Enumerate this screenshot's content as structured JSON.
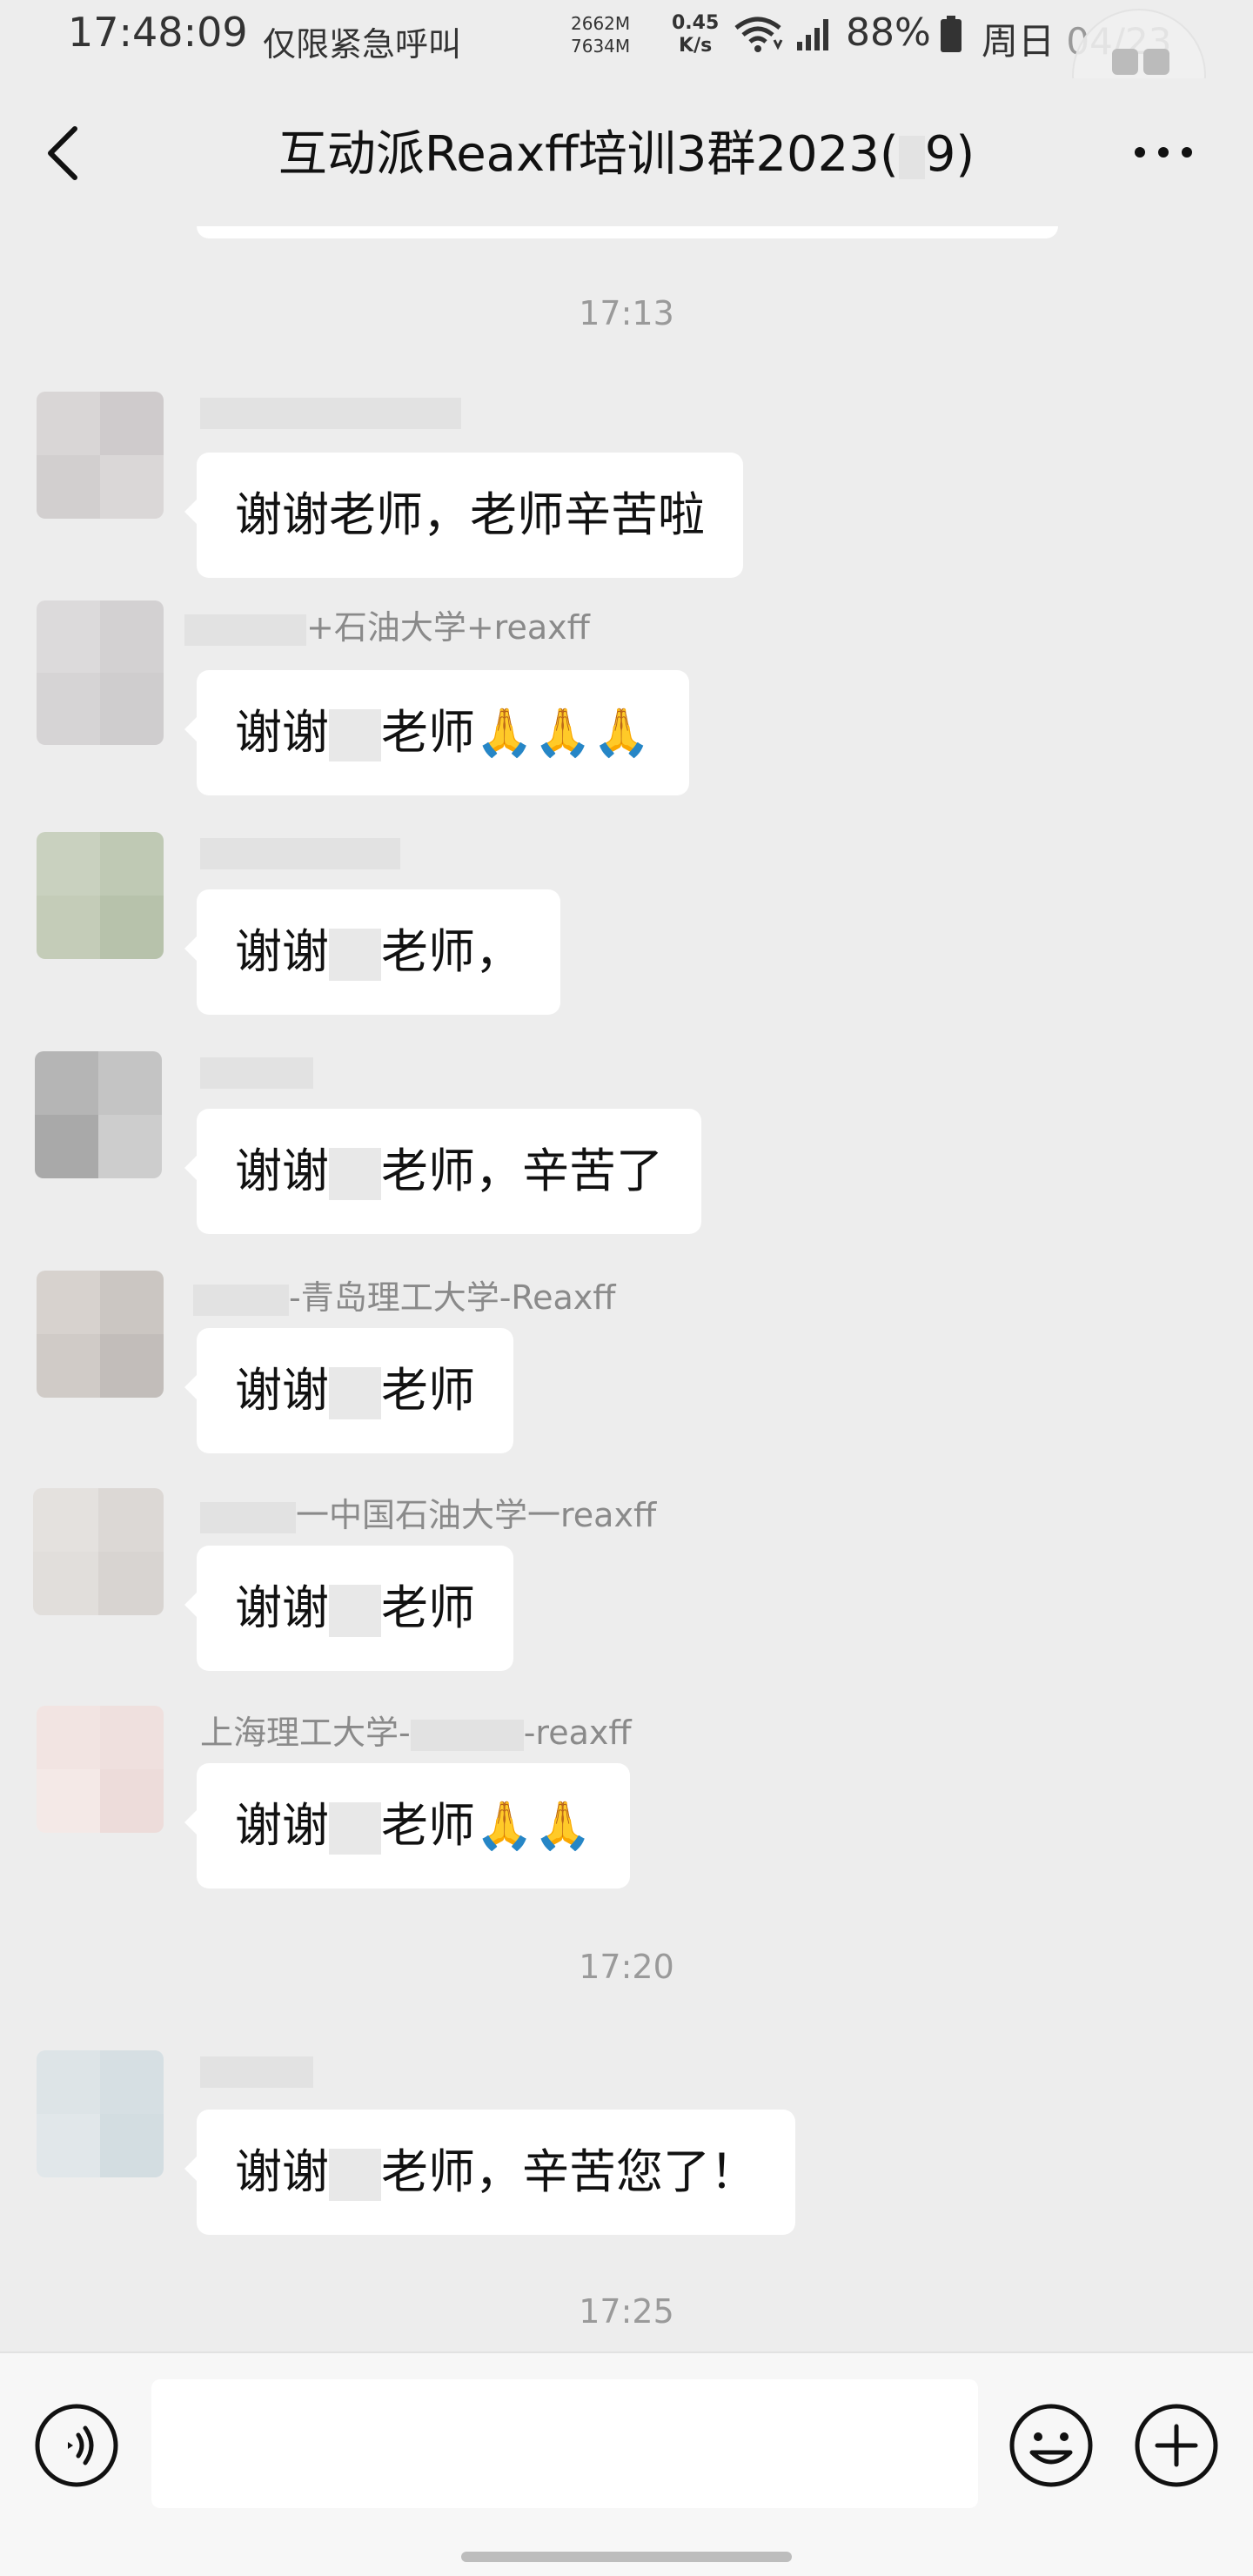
{
  "status_bar": {
    "time": "17:48:09",
    "emergency": "仅限紧急呼叫",
    "mem_top": "2662M",
    "mem_bottom": "7634M",
    "speed_value": "0.45",
    "speed_unit": "K/s",
    "battery": "88%",
    "weekday": "周日",
    "date": "04/23"
  },
  "nav": {
    "title_before": "互动派Reaxff培训3群2023(",
    "title_after": "9)"
  },
  "messages": [
    {
      "type": "time",
      "text": "17:13"
    },
    {
      "type": "msg",
      "sender_suffix": "",
      "parts": [
        "谢谢老师，老师辛苦啦"
      ]
    },
    {
      "type": "msg",
      "sender_suffix": "+石油大学+reaxff",
      "parts": [
        "谢谢",
        "老师",
        "🙏🙏🙏"
      ]
    },
    {
      "type": "msg",
      "sender_suffix": "",
      "parts": [
        "谢谢",
        "老师，"
      ]
    },
    {
      "type": "msg",
      "sender_suffix": "",
      "parts": [
        "谢谢",
        "老师，辛苦了"
      ]
    },
    {
      "type": "msg",
      "sender_suffix": "-青岛理工大学-Reaxff",
      "parts": [
        "谢谢",
        "老师"
      ]
    },
    {
      "type": "msg",
      "sender_suffix": "一中国石油大学一reaxff",
      "parts": [
        "谢谢",
        "老师"
      ]
    },
    {
      "type": "msg",
      "sender_prefix": "上海理工大学-",
      "sender_suffix": "-reaxff",
      "parts": [
        "谢谢",
        "老师",
        "🙏🙏"
      ]
    },
    {
      "type": "time",
      "text": "17:20"
    },
    {
      "type": "msg",
      "sender_suffix": "",
      "parts": [
        "谢谢",
        "老师，辛苦您了！"
      ]
    },
    {
      "type": "time",
      "text": "17:25"
    }
  ],
  "icons": {
    "back": "chevron-left-icon",
    "more": "more-dots-icon",
    "voice": "voice-icon",
    "emoji": "emoji-icon",
    "plus": "plus-icon"
  },
  "input": {
    "value": "",
    "placeholder": ""
  }
}
